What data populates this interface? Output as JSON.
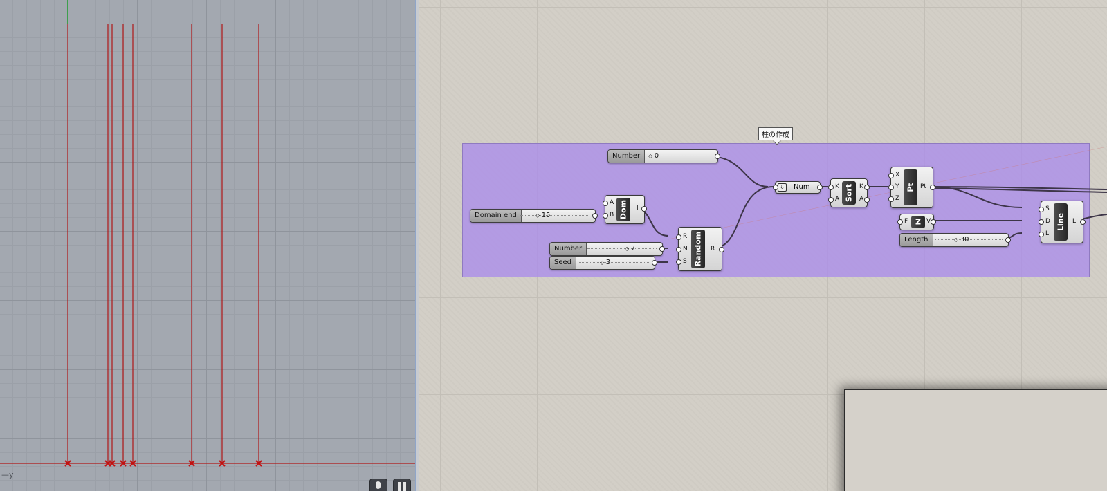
{
  "viewport": {
    "axis_label": "—y",
    "buttons": [
      {
        "icon": "microphone-icon"
      },
      {
        "icon": "pause-icon"
      }
    ],
    "colors": {
      "curve": "#b01818",
      "point_marker": "#c41010",
      "y_axis": "#1d9a2c",
      "grid": "#8f949c"
    }
  },
  "canvas": {
    "group": {
      "label": "柱の作成",
      "color": "#aa8ceb"
    },
    "sliders": {
      "number_top": {
        "name": "Number",
        "value": "0"
      },
      "domain_end": {
        "name": "Domain end",
        "value": "15"
      },
      "number_count": {
        "name": "Number",
        "value": "7"
      },
      "seed": {
        "name": "Seed",
        "value": "3"
      },
      "length": {
        "name": "Length",
        "value": "30"
      }
    },
    "components": {
      "dom": {
        "title": "Dom",
        "inputs": [
          "A",
          "B"
        ],
        "outputs": [
          "I"
        ]
      },
      "random": {
        "title": "Random",
        "inputs": [
          "R",
          "N",
          "S"
        ],
        "outputs": [
          "R"
        ]
      },
      "num": {
        "name": "Num",
        "icon": "number-param-icon"
      },
      "sort": {
        "title": "Sort",
        "inputs": [
          "K",
          "A"
        ],
        "outputs": [
          "K",
          "A"
        ]
      },
      "pt": {
        "title": "Pt",
        "inputs": [
          "X",
          "Y",
          "Z"
        ],
        "outputs": [
          "Pt"
        ]
      },
      "z": {
        "title": "Z",
        "inputs": [
          "F"
        ],
        "outputs": [
          "V"
        ]
      },
      "line": {
        "title": "Line",
        "inputs": [
          "S",
          "D",
          "L"
        ],
        "outputs": [
          "L"
        ]
      }
    }
  }
}
